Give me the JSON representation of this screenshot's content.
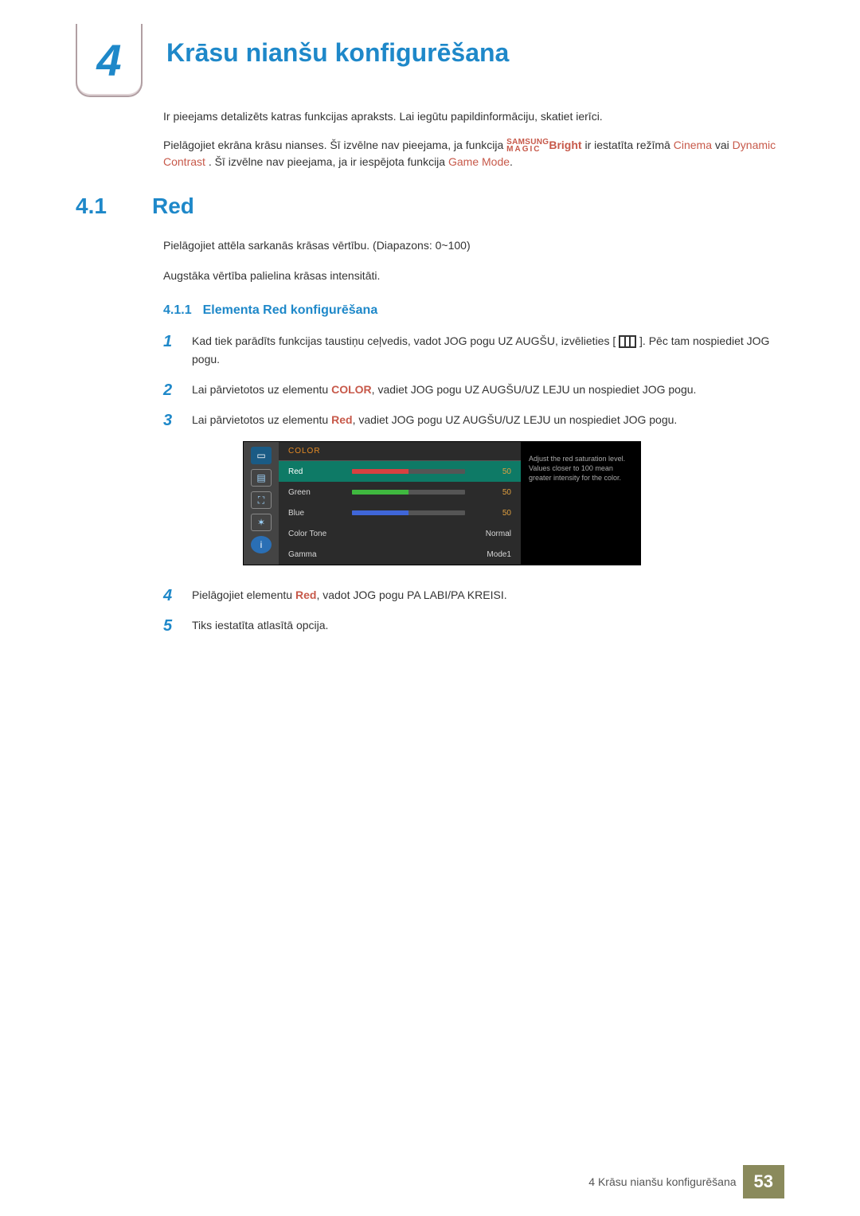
{
  "chapter": {
    "number": "4",
    "title": "Krāsu nianšu konfigurēšana"
  },
  "intro": {
    "line1": "Ir pieejams detalizēts katras funkcijas apraksts. Lai iegūtu papildinformāciju, skatiet ierīci.",
    "line2a": "Pielāgojiet ekrāna krāsu nianses. Šī izvēlne nav pieejama, ja funkcija ",
    "magic_top": "SAMSUNG",
    "magic_bot": "MAGIC",
    "bright": "Bright",
    "line2b": " ir iestatīta režīmā ",
    "cinema": "Cinema",
    "line3a": " vai ",
    "dyn": "Dynamic Contrast",
    "line3b": ". Šī izvēlne nav pieejama, ja ir iespējota funkcija ",
    "game": "Game Mode",
    "line3c": "."
  },
  "section": {
    "num": "4.1",
    "title": "Red",
    "p1": "Pielāgojiet attēla sarkanās krāsas vērtību. (Diapazons: 0~100)",
    "p2": "Augstāka vērtība palielina krāsas intensitāti."
  },
  "subsection": {
    "num": "4.1.1",
    "title": "Elementa Red konfigurēšana"
  },
  "steps": {
    "s1a": "Kad tiek parādīts funkcijas taustiņu ceļvedis, vadot JOG pogu UZ AUGŠU, izvēlieties [",
    "s1b": "]. Pēc tam nospiediet JOG pogu.",
    "s2a": "Lai pārvietotos uz elementu ",
    "s2_color": "COLOR",
    "s2b": ", vadiet JOG pogu UZ AUGŠU/UZ LEJU un nospiediet JOG pogu.",
    "s3a": "Lai pārvietotos uz elementu ",
    "s3_red": "Red",
    "s3b": ", vadiet JOG pogu UZ AUGŠU/UZ LEJU un nospiediet JOG pogu.",
    "s4a": "Pielāgojiet elementu ",
    "s4_red": "Red",
    "s4b": ", vadot JOG pogu PA LABI/PA KREISI.",
    "s5": "Tiks iestatīta atlasītā opcija."
  },
  "osd": {
    "head": "COLOR",
    "rows": {
      "red": {
        "label": "Red",
        "val": "50"
      },
      "green": {
        "label": "Green",
        "val": "50"
      },
      "blue": {
        "label": "Blue",
        "val": "50"
      },
      "tone": {
        "label": "Color Tone",
        "val": "Normal"
      },
      "gamma": {
        "label": "Gamma",
        "val": "Mode1"
      }
    },
    "help": "Adjust the red saturation level. Values closer to 100 mean greater intensity for the color."
  },
  "footer": {
    "title": "4 Krāsu nianšu konfigurēšana",
    "page": "53"
  }
}
